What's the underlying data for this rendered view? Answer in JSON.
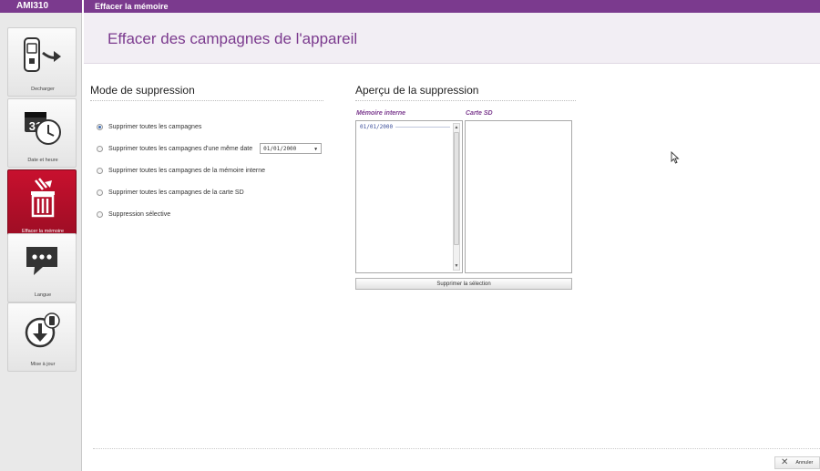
{
  "app": {
    "title": "AMI310"
  },
  "window": {
    "title": "Effacer la mémoire"
  },
  "sidebar": {
    "items": [
      {
        "label": "Decharger",
        "icon": "download-device-icon",
        "active": false
      },
      {
        "label": "Date et heure",
        "icon": "calendar-clock-icon",
        "active": false
      },
      {
        "label": "Effacer la mémoire",
        "icon": "trash-icon",
        "active": true
      },
      {
        "label": "Langue",
        "icon": "chat-bubble-icon",
        "active": false
      },
      {
        "label": "Mise à jour",
        "icon": "update-download-icon",
        "active": false
      }
    ]
  },
  "main": {
    "page_title": "Effacer des campagnes de l'appareil",
    "mode_section": {
      "title": "Mode de suppression",
      "options": [
        {
          "label": "Supprimer toutes les campagnes",
          "checked": true
        },
        {
          "label": "Supprimer toutes les campagnes d'une même date",
          "checked": false
        },
        {
          "label": "Supprimer toutes les campagnes de la mémoire interne",
          "checked": false
        },
        {
          "label": "Supprimer toutes les campagnes de la carte SD",
          "checked": false
        },
        {
          "label": "Suppression sélective",
          "checked": false
        }
      ],
      "date_select": {
        "value": "01/01/2000"
      }
    },
    "preview_section": {
      "title": "Aperçu de la suppression",
      "internal_label": "Mémoire interne",
      "sd_label": "Carte SD",
      "internal_entries": [
        "01/01/2000"
      ],
      "delete_button": "Supprimer la sélection"
    },
    "cancel_button": "Annuler"
  },
  "colors": {
    "accent": "#7b3a8e",
    "active_item": "#c8102e",
    "header_band": "#f2eef4"
  }
}
